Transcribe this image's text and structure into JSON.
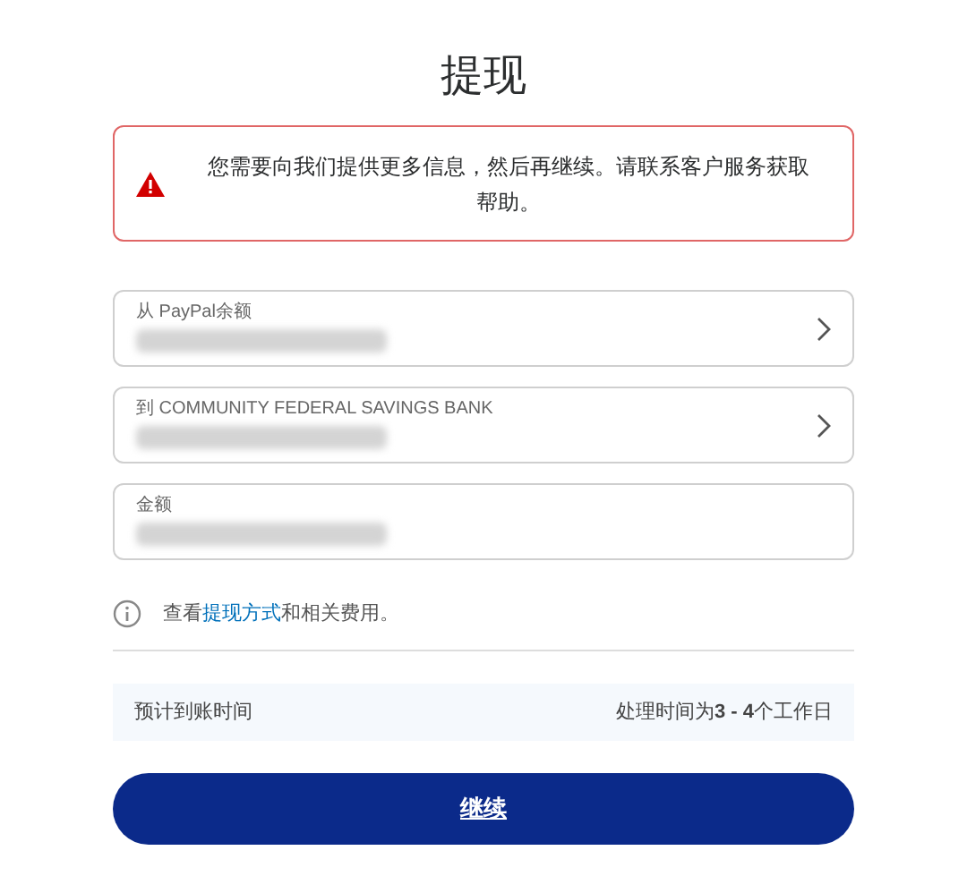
{
  "title": "提现",
  "alert": {
    "message": "您需要向我们提供更多信息，然后再继续。请联系客户服务获取帮助。"
  },
  "fields": [
    {
      "label": "从 PayPal余额",
      "kind": "select"
    },
    {
      "label": "到 COMMUNITY FEDERAL SAVINGS BANK",
      "kind": "select"
    },
    {
      "label": "金额",
      "kind": "input"
    }
  ],
  "info": {
    "before": "查看",
    "link": "提现方式",
    "after": "和相关费用。"
  },
  "estimate": {
    "label": "预计到账时间",
    "value": "处理时间为**3 - 4**个工作日"
  },
  "button": "继续"
}
